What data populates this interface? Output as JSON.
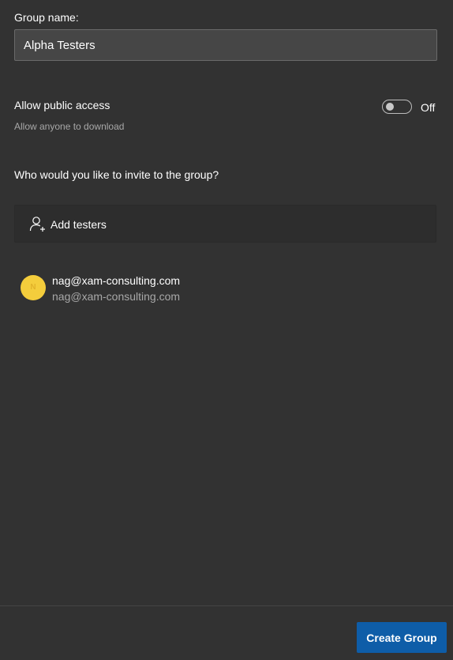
{
  "group_name": {
    "label": "Group name:",
    "value": "Alpha Testers"
  },
  "public_access": {
    "title": "Allow public access",
    "subtitle": "Allow anyone to download",
    "enabled": false,
    "state_label": "Off"
  },
  "invite": {
    "question": "Who would you like to invite to the group?",
    "add_testers_label": "Add testers",
    "add_testers_icon": "add-user-icon"
  },
  "testers": [
    {
      "initial": "N",
      "name": "nag@xam-consulting.com",
      "email": "nag@xam-consulting.com",
      "avatar_color": "#f4cd3c"
    }
  ],
  "footer": {
    "create_label": "Create Group"
  },
  "colors": {
    "background": "#323232",
    "accent": "#0e5da8"
  }
}
